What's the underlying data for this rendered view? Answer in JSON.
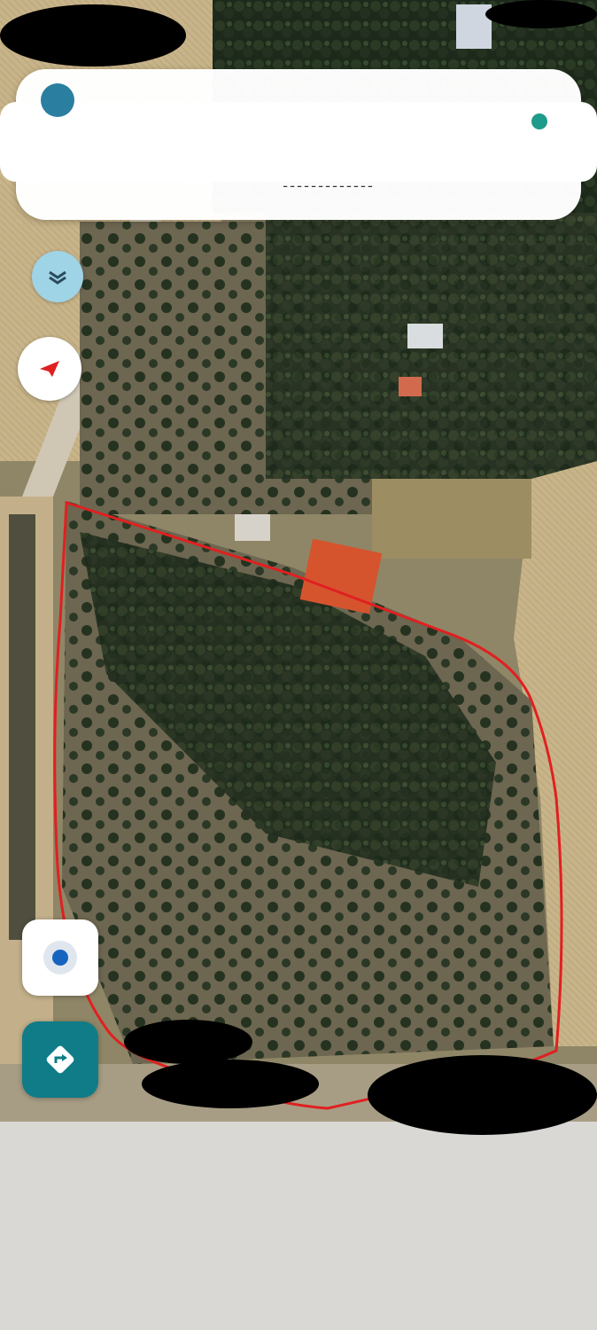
{
  "search": {
    "text": "ـ ـ ـ ـ ـ ـ ـ ـ ـ ـ ـ ـ ـ"
  },
  "map": {
    "type": "satellite",
    "boundary_color": "#e02020"
  },
  "colors": {
    "route_button": "#0f7c88",
    "layers_button": "#9fd3e6",
    "locate_dot": "#1565c0"
  },
  "icons": {
    "layers": "layers-chevron-icon",
    "compass": "compass-icon",
    "locate": "my-location-icon",
    "route": "directions-icon"
  }
}
